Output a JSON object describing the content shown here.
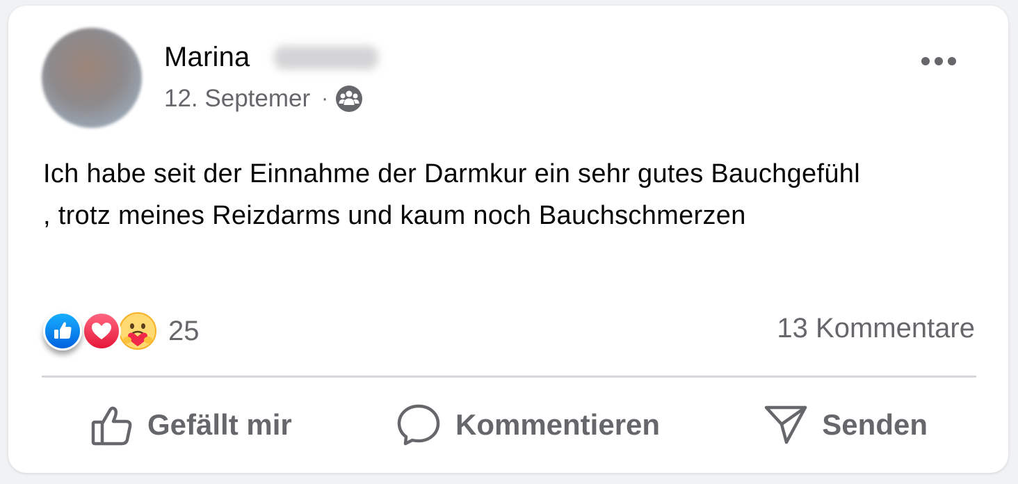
{
  "post": {
    "author": "Marina",
    "date": "12. Septemer",
    "separator": "·",
    "audience_icon": "group-icon",
    "text": "Ich habe seit der Einnahme der Darmkur ein sehr gutes Bauchgefühl , trotz meines Reizdarms und kaum noch Bauchschmerzen"
  },
  "reactions": {
    "types": [
      "like-icon",
      "love-icon",
      "care-icon"
    ],
    "count": "25",
    "comments": "13 Kommentare"
  },
  "actions": {
    "like": "Gefällt mir",
    "comment": "Kommentieren",
    "send": "Senden"
  },
  "colors": {
    "like_blue": "#0866ff",
    "love_red": "#f33e58",
    "secondary_text": "#65676b"
  }
}
